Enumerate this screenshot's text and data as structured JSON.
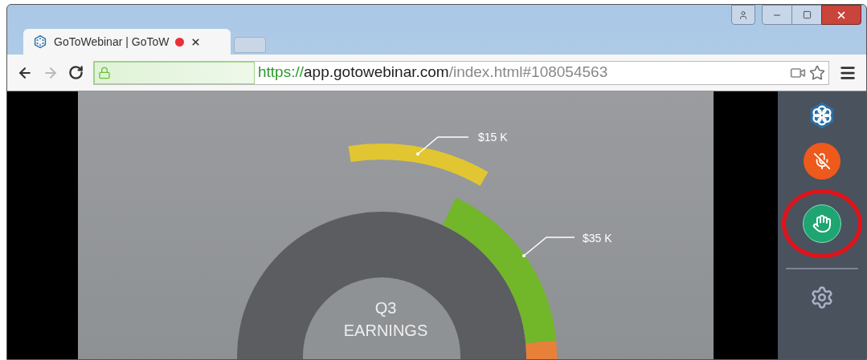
{
  "browser": {
    "tab": {
      "title": "GoToWebinar | GoToW",
      "recording": true,
      "selected": true
    },
    "url": {
      "scheme": "https://",
      "host": "app.gotowebinar.com",
      "path": "/index.html#108054563"
    }
  },
  "slide": {
    "labels": [
      {
        "text": "$15 K"
      },
      {
        "text": "$35 K"
      }
    ],
    "center_title": [
      "Q3",
      "EARNINGS"
    ]
  },
  "sidebar": {
    "buttons": [
      {
        "kind": "logo"
      },
      {
        "kind": "mic",
        "muted": true
      },
      {
        "kind": "hand",
        "highlighted": true
      },
      {
        "kind": "divider"
      },
      {
        "kind": "settings"
      }
    ]
  }
}
